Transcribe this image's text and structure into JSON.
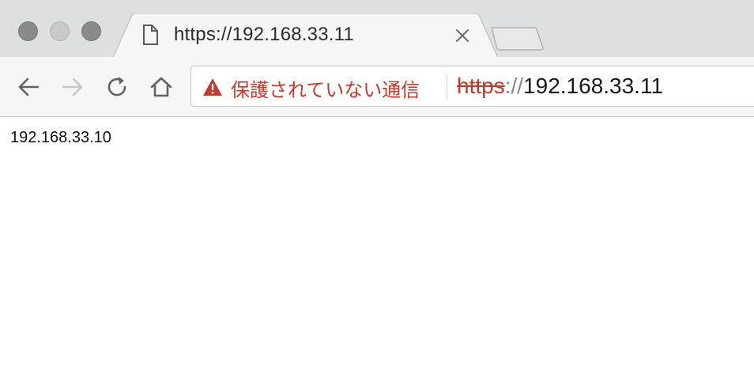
{
  "window": {
    "traffic_lights": [
      "close",
      "minimize",
      "maximize"
    ]
  },
  "tab": {
    "icon": "document-icon",
    "title": "https://192.168.33.11",
    "close_icon": "close-icon"
  },
  "toolbar": {
    "back_icon": "back-arrow-icon",
    "forward_icon": "forward-arrow-icon",
    "reload_icon": "reload-icon",
    "home_icon": "home-icon"
  },
  "omnibox": {
    "security_icon": "warning-triangle-icon",
    "security_label": "保護されていない通信",
    "url_scheme": "https",
    "url_separator": "://",
    "url_host": "192.168.33.11"
  },
  "page": {
    "body_text": "192.168.33.10"
  },
  "colors": {
    "insecure_red": "#c5392b",
    "tabstrip_bg": "#dedfe0",
    "toolbar_bg": "#f6f6f7"
  }
}
